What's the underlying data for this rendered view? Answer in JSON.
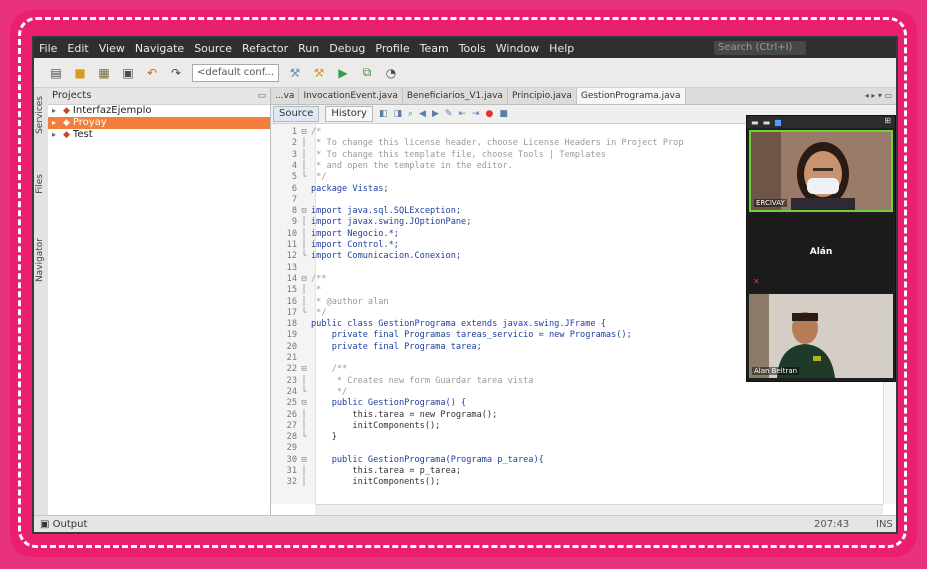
{
  "menubar": {
    "items": [
      "File",
      "Edit",
      "View",
      "Navigate",
      "Source",
      "Refactor",
      "Run",
      "Debug",
      "Profile",
      "Team",
      "Tools",
      "Window",
      "Help"
    ],
    "search_placeholder": "Search (Ctrl+I)"
  },
  "toolbar": {
    "config_select": "<default conf..."
  },
  "sidetabs": [
    "Services",
    "Files",
    "Navigator"
  ],
  "projects_panel": {
    "title": "Projects",
    "tree": [
      {
        "label": "InterfazEjemplo",
        "selected": false
      },
      {
        "label": "Proyay",
        "selected": true
      },
      {
        "label": "Test",
        "selected": false
      }
    ]
  },
  "editor": {
    "tabs": [
      "...va",
      "InvocationEvent.java",
      "Beneficiarios_V1.java",
      "Principio.java",
      "GestionPrograma.java"
    ],
    "source_label": "Source",
    "history_label": "History",
    "lines": [
      {
        "n": "1",
        "fold": "⊟",
        "text": "/*",
        "cls": "comment"
      },
      {
        "n": "2",
        "fold": "│",
        "text": " * To change this license header, choose License Headers in Project Prop",
        "cls": "comment"
      },
      {
        "n": "3",
        "fold": "│",
        "text": " * To change this template file, choose Tools | Templates",
        "cls": "comment"
      },
      {
        "n": "4",
        "fold": "│",
        "text": " * and open the template in the editor.",
        "cls": "comment"
      },
      {
        "n": "5",
        "fold": "└",
        "text": " */",
        "cls": "comment"
      },
      {
        "n": "6",
        "fold": "",
        "text": "package Vistas;",
        "cls": "kw"
      },
      {
        "n": "7",
        "fold": "",
        "text": "",
        "cls": "code"
      },
      {
        "n": "8",
        "fold": "⊟",
        "text": "import java.sql.SQLException;",
        "cls": "kw"
      },
      {
        "n": "9",
        "fold": "│",
        "text": "import javax.swing.JOptionPane;",
        "cls": "kw"
      },
      {
        "n": "10",
        "fold": "│",
        "text": "import Negocio.*;",
        "cls": "kw"
      },
      {
        "n": "11",
        "fold": "│",
        "text": "import Control.*;",
        "cls": "kw"
      },
      {
        "n": "12",
        "fold": "└",
        "text": "import Comunicacion.Conexion;",
        "cls": "kw"
      },
      {
        "n": "13",
        "fold": "",
        "text": "",
        "cls": "code"
      },
      {
        "n": "14",
        "fold": "⊟",
        "text": "/**",
        "cls": "comment"
      },
      {
        "n": "15",
        "fold": "│",
        "text": " *",
        "cls": "comment"
      },
      {
        "n": "16",
        "fold": "│",
        "text": " * @author alan",
        "cls": "comment"
      },
      {
        "n": "17",
        "fold": "└",
        "text": " */",
        "cls": "comment"
      },
      {
        "n": "18",
        "fold": "",
        "text": "public class GestionPrograma extends javax.swing.JFrame {",
        "cls": "kw"
      },
      {
        "n": "19",
        "fold": "",
        "text": "    private final Programas tareas_servicio = new Programas();",
        "cls": "kw"
      },
      {
        "n": "20",
        "fold": "",
        "text": "    private final Programa tarea;",
        "cls": "kw"
      },
      {
        "n": "21",
        "fold": "",
        "text": "",
        "cls": "code"
      },
      {
        "n": "22",
        "fold": "⊟",
        "text": "    /**",
        "cls": "comment"
      },
      {
        "n": "23",
        "fold": "│",
        "text": "     * Creates new form Guardar tarea vista",
        "cls": "comment"
      },
      {
        "n": "24",
        "fold": "└",
        "text": "     */",
        "cls": "comment"
      },
      {
        "n": "25",
        "fold": "⊟",
        "text": "    public GestionPrograma() {",
        "cls": "kw"
      },
      {
        "n": "26",
        "fold": "│",
        "text": "        this.tarea = new Programa();",
        "cls": "code"
      },
      {
        "n": "27",
        "fold": "│",
        "text": "        initComponents();",
        "cls": "code"
      },
      {
        "n": "28",
        "fold": "└",
        "text": "    }",
        "cls": "code"
      },
      {
        "n": "29",
        "fold": "",
        "text": "",
        "cls": "code"
      },
      {
        "n": "30",
        "fold": "⊟",
        "text": "    public GestionPrograma(Programa p_tarea){",
        "cls": "kw"
      },
      {
        "n": "31",
        "fold": "│",
        "text": "        this.tarea = p_tarea;",
        "cls": "code"
      },
      {
        "n": "32",
        "fold": "│",
        "text": "        initComponents();",
        "cls": "code"
      }
    ]
  },
  "statusbar": {
    "output_label": "Output",
    "position": "207:43",
    "mode": "INS"
  },
  "zoom": {
    "tile1_name": "ERCIVAY",
    "tile2_name": "Alán",
    "tile3_name": "Alan Beltran"
  }
}
